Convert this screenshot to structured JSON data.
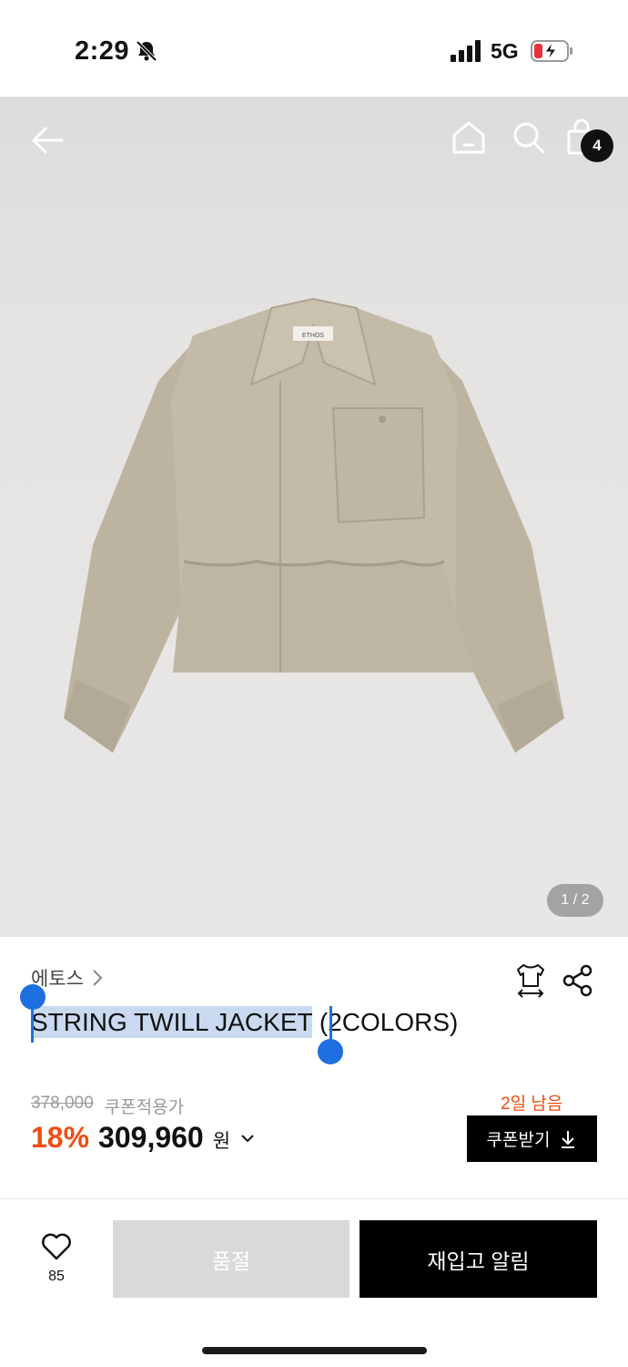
{
  "status_bar": {
    "time": "2:29",
    "network": "5G",
    "icons": [
      "bell-off-icon",
      "signal-icon",
      "battery-charging-icon"
    ]
  },
  "header": {
    "icons": [
      "back-arrow-icon",
      "home-icon",
      "search-icon",
      "shopping-bag-icon"
    ],
    "cart_count": "4"
  },
  "gallery": {
    "page_indicator": "1 / 2",
    "label_on_garment": "ETHOS"
  },
  "product": {
    "brand": "에토스",
    "title_selected": "STRING TWILL JACKET",
    "title_rest": " (2COLORS)",
    "original_price": "378,000",
    "coupon_label": "쿠폰적용가",
    "discount": "18%",
    "price": "309,960",
    "currency": "원",
    "coupon_days_left": "2일 남음",
    "coupon_button": "쿠폰받기"
  },
  "bottom_bar": {
    "like_count": "85",
    "soldout_label": "품절",
    "restock_label": "재입고 알림"
  },
  "colors": {
    "accent": "#f04d12",
    "selection": "#c9daf0",
    "selection_handle": "#1e6fe0",
    "jacket": "#c2b8a6"
  }
}
